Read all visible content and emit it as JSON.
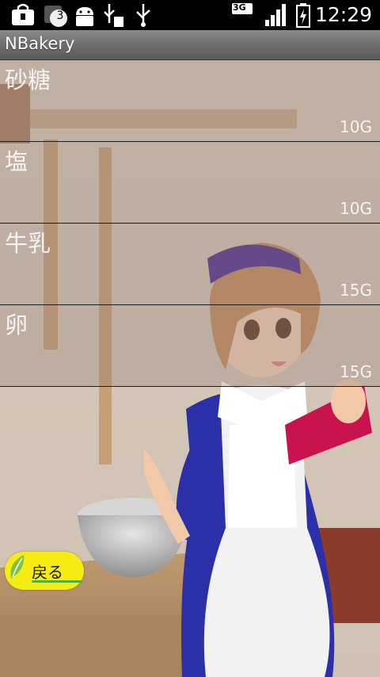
{
  "status_bar": {
    "notification_count": "3",
    "network": "3G",
    "time": "12:29",
    "icons": [
      "shopping-bag-icon",
      "notification-count-icon",
      "android-debug-icon",
      "usb-sd-icon",
      "usb-icon",
      "network-3g-icon",
      "signal-icon",
      "battery-icon"
    ]
  },
  "app": {
    "title": "NBakery"
  },
  "ingredients": [
    {
      "name": "砂糖",
      "quantity": "10G"
    },
    {
      "name": "塩",
      "quantity": "10G"
    },
    {
      "name": "牛乳",
      "quantity": "15G"
    },
    {
      "name": "卵",
      "quantity": "15G"
    }
  ],
  "back_button": {
    "label": "戻る"
  },
  "colors": {
    "back_button": "#f6ec14",
    "wall": "#d9cbbd",
    "counter": "#b8956a",
    "maid_dress": "#2b2fa8",
    "book": "#c8134e"
  }
}
